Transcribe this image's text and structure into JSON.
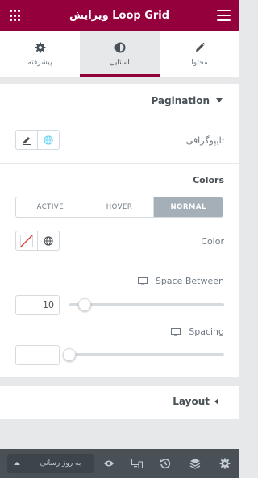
{
  "header": {
    "title": "ویرایش Loop Grid"
  },
  "tabs": [
    {
      "label": "محتوا",
      "icon": "pencil-icon"
    },
    {
      "label": "استایل",
      "icon": "contrast-icon",
      "active": true
    },
    {
      "label": "پیشرفته",
      "icon": "gear-icon"
    }
  ],
  "pagination": {
    "title": "Pagination",
    "typography_label": "تایپوگرافی",
    "colors_label": "Colors",
    "states": [
      "ACTIVE",
      "HOVER",
      "NORMAL"
    ],
    "active_state": "NORMAL",
    "color_label": "Color",
    "space_between": {
      "label": "Space Between",
      "value": "10"
    },
    "spacing": {
      "label": "Spacing",
      "value": ""
    }
  },
  "layout_section": {
    "title": "Layout"
  },
  "footer": {
    "update_label": "به روز رسانی"
  },
  "colors": {
    "brand": "#93003c",
    "panel_bg": "#e6e8ea",
    "footer_bg": "#495157"
  }
}
